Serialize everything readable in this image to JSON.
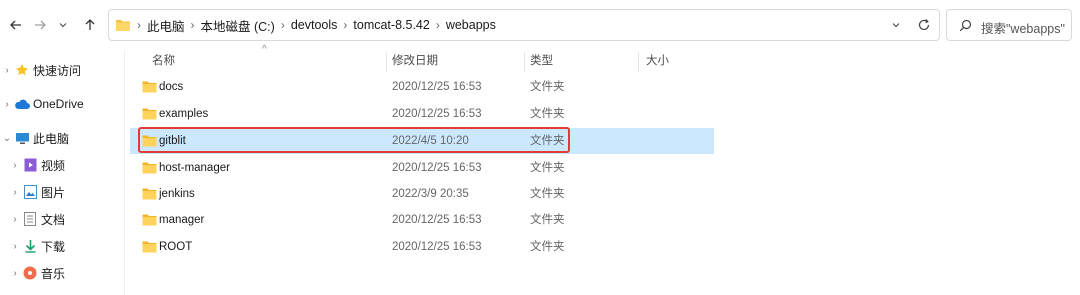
{
  "breadcrumbs": [
    "此电脑",
    "本地磁盘 (C:)",
    "devtools",
    "tomcat-8.5.42",
    "webapps"
  ],
  "search_placeholder": "搜索\"webapps\"",
  "columns": {
    "name": "名称",
    "modified": "修改日期",
    "type": "类型",
    "size": "大小"
  },
  "nav": [
    {
      "label": "快速访问",
      "icon": "star-icon"
    },
    {
      "label": "OneDrive",
      "icon": "cloud-icon"
    },
    {
      "label": "此电脑",
      "icon": "computer-icon"
    },
    {
      "label": "视频",
      "icon": "video-icon"
    },
    {
      "label": "图片",
      "icon": "picture-icon"
    },
    {
      "label": "文档",
      "icon": "document-icon"
    },
    {
      "label": "下载",
      "icon": "download-icon"
    },
    {
      "label": "音乐",
      "icon": "music-icon"
    }
  ],
  "files": [
    {
      "name": "docs",
      "modified": "2020/12/25 16:53",
      "type": "文件夹"
    },
    {
      "name": "examples",
      "modified": "2020/12/25 16:53",
      "type": "文件夹"
    },
    {
      "name": "gitblit",
      "modified": "2022/4/5 10:20",
      "type": "文件夹",
      "selected": true
    },
    {
      "name": "host-manager",
      "modified": "2020/12/25 16:53",
      "type": "文件夹"
    },
    {
      "name": "jenkins",
      "modified": "2022/3/9 20:35",
      "type": "文件夹"
    },
    {
      "name": "manager",
      "modified": "2020/12/25 16:53",
      "type": "文件夹"
    },
    {
      "name": "ROOT",
      "modified": "2020/12/25 16:53",
      "type": "文件夹"
    }
  ],
  "colors": {
    "selection": "#cce8ff",
    "highlight_box": "#e53935",
    "folder": "#f5c242"
  }
}
